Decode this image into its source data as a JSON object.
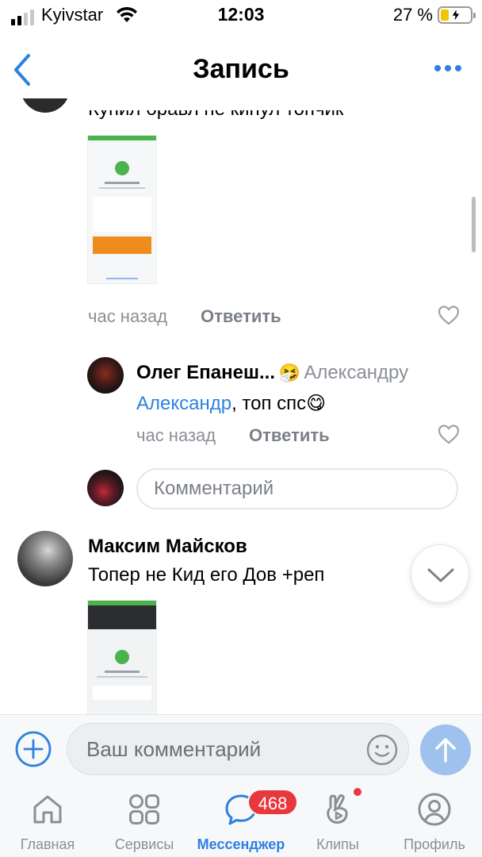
{
  "status_bar": {
    "carrier": "Kyivstar",
    "time": "12:03",
    "battery_percent": "27 %",
    "battery_level": 0.27
  },
  "header": {
    "title": "Запись"
  },
  "comments": {
    "top": {
      "text": "Купил бравл не кинул топчик",
      "time": "час назад",
      "reply_label": "Ответить"
    },
    "reply": {
      "author": "Олег Епанеш...",
      "author_emoji": "🤧",
      "reply_to": "Александру",
      "mention": "Александр",
      "text": ", топ спс",
      "emoji": "😋",
      "time": "час назад",
      "reply_label": "Ответить"
    },
    "reply_field_placeholder": "Комментарий",
    "next": {
      "author": "Максим Майсков",
      "text": "Топер не Кид его Дов +реп"
    }
  },
  "composer": {
    "placeholder": "Ваш комментарий"
  },
  "tab_bar": {
    "items": [
      {
        "label": "Главная",
        "icon": "home-icon"
      },
      {
        "label": "Сервисы",
        "icon": "services-icon"
      },
      {
        "label": "Мессенджер",
        "icon": "messenger-icon",
        "active": true
      },
      {
        "label": "Клипы",
        "icon": "clips-icon"
      },
      {
        "label": "Профиль",
        "icon": "profile-icon"
      }
    ],
    "messenger_badge": "468"
  },
  "colors": {
    "accent": "#2d81e0",
    "badge": "#e8383e",
    "muted": "#8a8f96",
    "send_button": "#9ec1ee"
  }
}
